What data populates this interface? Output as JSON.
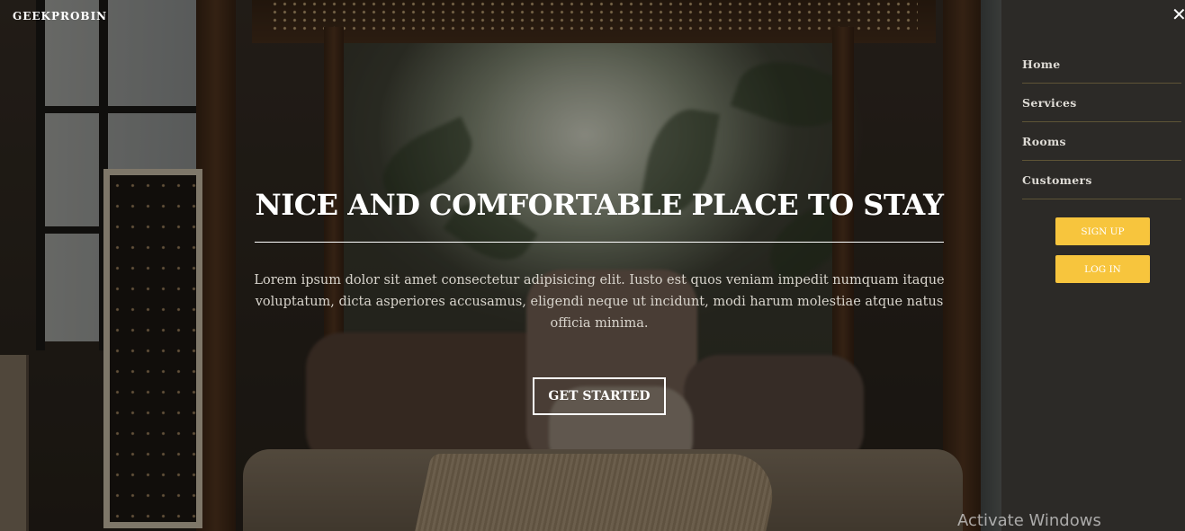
{
  "brand": {
    "name": "GEEKPROBIN"
  },
  "hero": {
    "title": "NICE AND COMFORTABLE PLACE TO STAY",
    "text": "Lorem ipsum dolor sit amet consectetur adipisicing elit. Iusto est quos veniam impedit numquam itaque voluptatum, dicta asperiores accusamus, eligendi neque ut incidunt, modi harum molestiae atque natus officia minima.",
    "cta_label": "GET STARTED"
  },
  "sidebar": {
    "close_icon": "close-icon",
    "close_glyph": "✕",
    "items": [
      {
        "label": "Home"
      },
      {
        "label": "Services"
      },
      {
        "label": "Rooms"
      },
      {
        "label": "Customers"
      }
    ],
    "signup_label": "SIGN UP",
    "login_label": "LOG IN"
  },
  "system": {
    "watermark": "Activate Windows"
  },
  "colors": {
    "accent": "#f7c53d",
    "sidebar_bg": "#2c2a27",
    "divider": "#5e5436"
  }
}
